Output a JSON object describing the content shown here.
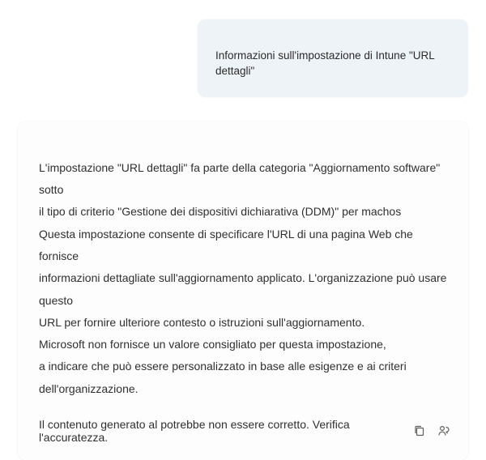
{
  "user_message": {
    "text": "Informazioni sull'impostazione di Intune \"URL dettagli\""
  },
  "assistant_message": {
    "paragraph1_line1": "L'impostazione \"URL dettagli\" fa parte della categoria \"Aggiornamento software\" sotto",
    "paragraph1_line2": "il tipo di criterio \"Gestione dei dispositivi dichiarativa (DDM)\" per machos",
    "paragraph2_line1": "Questa impostazione consente di specificare l'URL di una pagina Web che fornisce",
    "paragraph2_line2": "informazioni dettagliate sull'aggiornamento applicato. L'organizzazione può usare questo",
    "paragraph2_line3": "URL per fornire ulteriore contesto o istruzioni sull'aggiornamento.",
    "paragraph3_line1": "Microsoft non fornisce un valore consigliato per questa impostazione,",
    "paragraph3_line2": "a indicare che può essere personalizzato in base alle esigenze e ai criteri",
    "paragraph3_line3": "dell'organizzazione.",
    "disclaimer": "Il contenuto generato al potrebbe non essere corretto. Verifica l'accuratezza."
  },
  "icons": {
    "copy": "copy-icon",
    "feedback": "feedback-icon"
  }
}
